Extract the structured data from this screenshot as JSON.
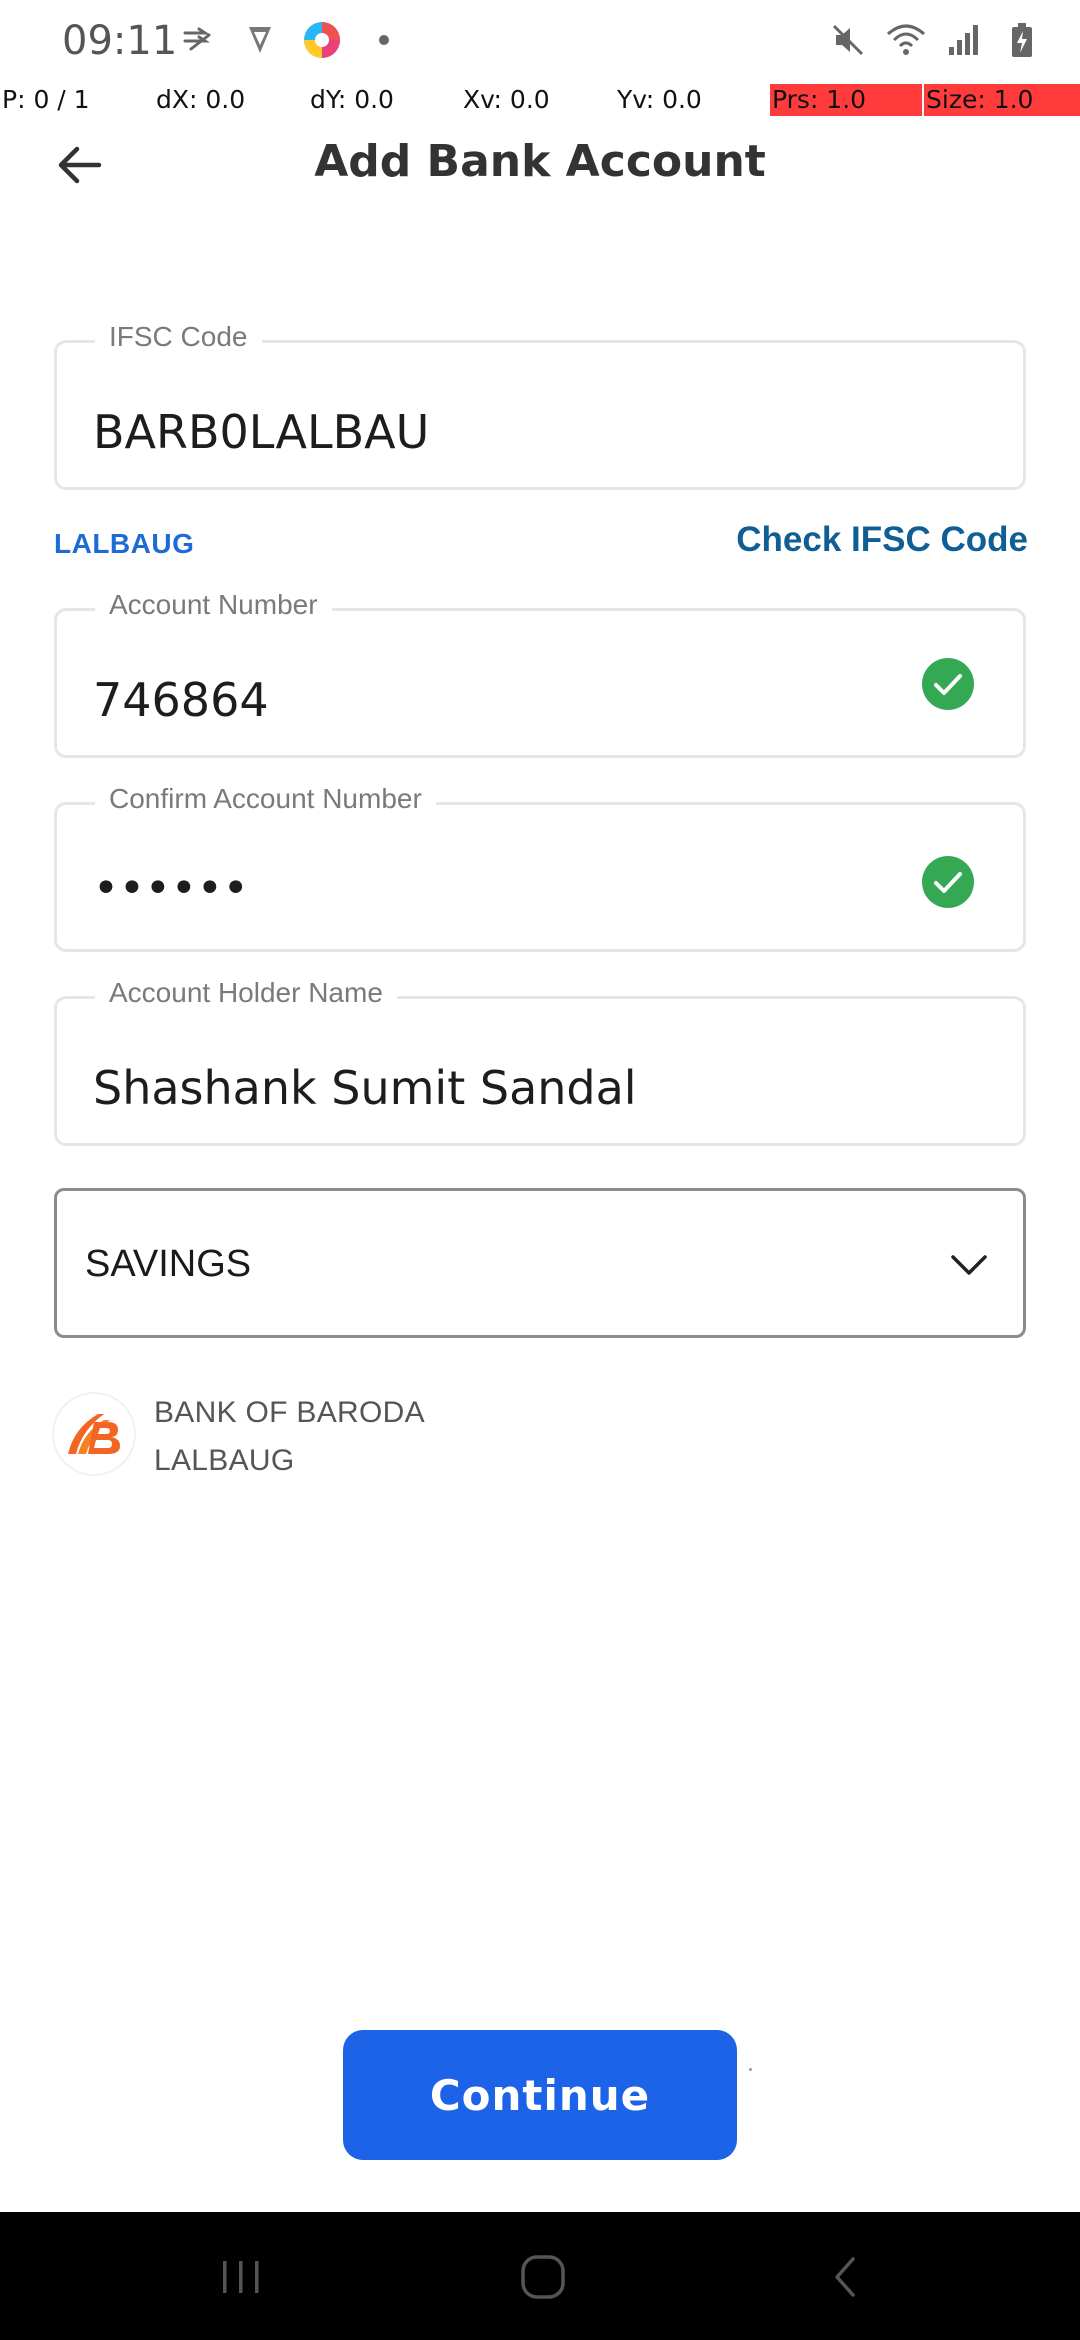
{
  "status_bar": {
    "time": "09:11",
    "left_icons": [
      "swipe-app-icon",
      "vpn-icon",
      "colorful-app-icon",
      "more-dot-icon"
    ],
    "right_icons": [
      "mute-icon",
      "wifi-icon",
      "signal-icon",
      "battery-charging-icon"
    ]
  },
  "debug": {
    "pointer": "P: 0 / 1",
    "dx": "dX: 0.0",
    "dy": "dY: 0.0",
    "xv": "Xv: 0.0",
    "yv": "Yv: 0.0",
    "prs": "Prs: 1.0",
    "size": "Size: 1.0"
  },
  "header": {
    "title": "Add Bank Account"
  },
  "form": {
    "ifsc": {
      "label": "IFSC Code",
      "value": "BARB0LALBAU"
    },
    "ifsc_branch": "LALBAUG",
    "check_ifsc_label": "Check IFSC Code",
    "account_number": {
      "label": "Account Number",
      "value": "746864"
    },
    "confirm_account_number": {
      "label": "Confirm Account Number",
      "value": "••••••"
    },
    "holder_name": {
      "label": "Account Holder Name",
      "value": "Shashank Sumit Sandal"
    },
    "account_type": {
      "selected": "SAVINGS"
    }
  },
  "bank": {
    "name": "BANK OF BARODA",
    "branch": "LALBAUG",
    "brand_color": "#f26522"
  },
  "continue_label": "Continue",
  "colors": {
    "primary": "#1d63e8",
    "link": "#0f5f96",
    "success": "#34a853"
  }
}
